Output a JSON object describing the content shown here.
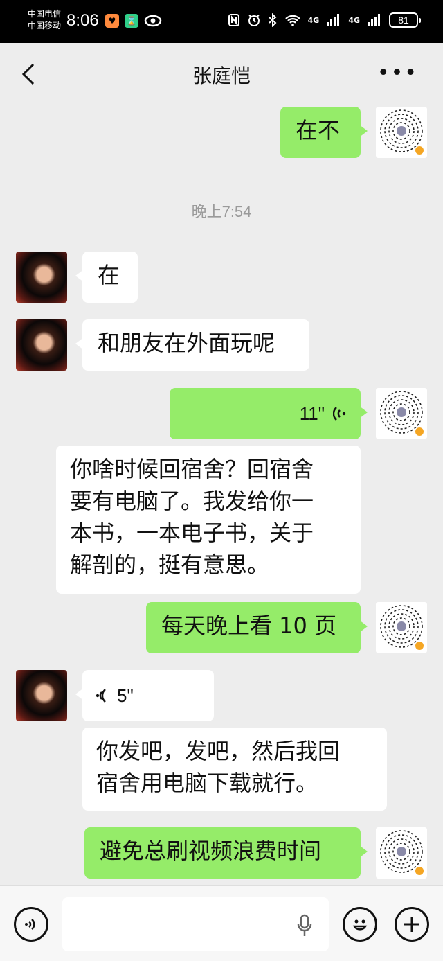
{
  "status_bar": {
    "carrier_1": "中国电信",
    "carrier_2": "中国移动",
    "time": "8:06",
    "network_1": "4G",
    "network_2": "4G",
    "battery": "81"
  },
  "header": {
    "contact_name": "张庭恺"
  },
  "messages": [
    {
      "sender": "me",
      "type": "text",
      "text": "在不"
    },
    {
      "type": "timestamp",
      "text": "晚上7:54"
    },
    {
      "sender": "contact",
      "type": "text",
      "text": "在"
    },
    {
      "sender": "contact",
      "type": "text",
      "text": "和朋友在外面玩呢"
    },
    {
      "sender": "me",
      "type": "voice",
      "duration": "11\""
    },
    {
      "sender": "contact",
      "type": "text",
      "text_lines": [
        "你啥时候回宿舍？回宿舍",
        "要有电脑了。我发给你一",
        "本书，一本电子书，关于",
        "解剖的，挺有意思。"
      ]
    },
    {
      "sender": "me",
      "type": "text",
      "text": "每天晚上看 10 页"
    },
    {
      "sender": "contact",
      "type": "voice",
      "duration": "5\""
    },
    {
      "sender": "contact",
      "type": "text",
      "text_lines": [
        "你发吧，发吧，然后我回",
        "宿舍用电脑下载就行。"
      ]
    },
    {
      "sender": "me",
      "type": "text",
      "text": "避免总刷视频浪费时间"
    }
  ],
  "colors": {
    "my_bubble": "#95ec69",
    "contact_bubble": "#ffffff",
    "background": "#ededed"
  }
}
